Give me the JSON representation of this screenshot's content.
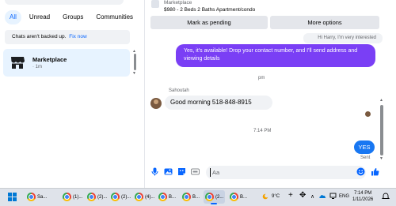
{
  "sidebar": {
    "filters": [
      "All",
      "Unread",
      "Groups",
      "Communities"
    ],
    "active_filter": "All",
    "backup_notice": "Chats aren't backed up.",
    "backup_fix": "Fix now",
    "conversation": {
      "name": "Marketplace",
      "time": "· 1m",
      "icon": "storefront-icon"
    }
  },
  "chat": {
    "header": {
      "title": "Marketplace",
      "subtitle": "$980 - 2 Beds 2 Baths Apartment/condo",
      "mark_pending_label": "Mark as pending",
      "more_options_label": "More options"
    },
    "messages": {
      "quoted": "Hi Harry, I'm very interested",
      "outgoing_reply": "Yes, it's available! Drop your contact number, and I'll send address and viewing details",
      "time_marker_1": "pm",
      "sender_name": "Sahoutah",
      "incoming": "Good morning 518-848-8915",
      "time_marker_2": "7:14 PM",
      "outgoing_short": "YES",
      "status": "Sent"
    },
    "composer": {
      "placeholder": "Aa"
    },
    "colors": {
      "accent": "#1877f2",
      "outgoing_purple": "#7a3ff5",
      "bubble_gray": "#f0f2f5"
    }
  },
  "taskbar": {
    "items": [
      {
        "label": "Sa...",
        "icon": "chrome-icon"
      },
      {
        "label": "(1)...",
        "icon": "chrome-icon"
      },
      {
        "label": "(2)...",
        "icon": "chrome-icon"
      },
      {
        "label": "(2)...",
        "icon": "chrome-icon"
      },
      {
        "label": "(4)...",
        "icon": "chrome-icon"
      },
      {
        "label": "B...",
        "icon": "chrome-icon"
      },
      {
        "label": "B...",
        "icon": "chrome-icon"
      },
      {
        "label": "(2...",
        "icon": "chrome-icon"
      },
      {
        "label": "B...",
        "icon": "chrome-icon"
      }
    ],
    "weather": "9°C",
    "language": "ENG",
    "time": "7:14 PM",
    "date": "1/11/2026"
  }
}
